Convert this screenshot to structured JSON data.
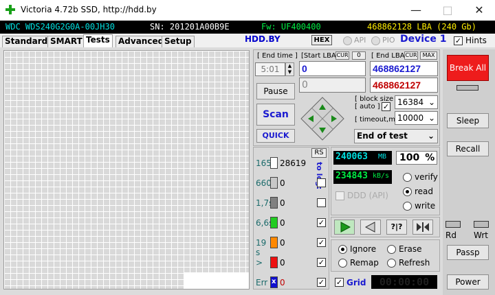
{
  "window": {
    "title": "Victoria 4.72b SSD, http://hdd.by"
  },
  "infobar": {
    "model": "WDC WDS240G2G0A-00JH30",
    "serial": "SN: 201201A00B9E",
    "firmware": "Fw: UF400400",
    "capacity": "468862128 LBA (240 Gb)"
  },
  "tabs": [
    "Standard",
    "SMART",
    "Tests",
    "Advanced",
    "Setup"
  ],
  "header": {
    "site": "HDD.BY",
    "hex": "HEX",
    "api": "API",
    "pio": "PIO",
    "device": "Device 1",
    "hints": "Hints"
  },
  "times": {
    "end_time_label": "[ End time ]",
    "end_time": "5:01",
    "start_lba_label": "[Start LBA]",
    "cur": "CUR",
    "zero": "0",
    "end_lba_label": "[ End LBA]",
    "max": "MAX",
    "start_lba": "0",
    "end_lba": "468862127",
    "cur_lba": "0",
    "end_lba_red": "468862127"
  },
  "controls": {
    "pause": "Pause",
    "scan": "Scan",
    "quick": "QUICK",
    "block_size_label": "[ block size ]",
    "auto_label": "[ auto ]",
    "block_size": "16384",
    "timeout_label": "[ timeout,ms ]",
    "timeout": "10000",
    "end_action": "End of test"
  },
  "stats": {
    "rs": "RS",
    "to_log": "to log:",
    "rows": [
      {
        "label": "165",
        "count": "28619",
        "color": "#ffffff"
      },
      {
        "label": "660",
        "count": "0",
        "color": "#c8c8c8"
      },
      {
        "label": "1,7s",
        "count": "0",
        "color": "#808080"
      },
      {
        "label": "6,6s",
        "count": "0",
        "color": "#22cc22"
      },
      {
        "label": "19 s",
        "count": "0",
        "color": "#ff8800"
      },
      {
        "label": ">",
        "count": "0",
        "color": "#ee1111"
      },
      {
        "label": "Err",
        "count": "0",
        "color": "#1010d0"
      }
    ]
  },
  "progress": {
    "mb": "240063",
    "mb_unit": "MB",
    "percent": "100",
    "percent_unit": "%",
    "speed": "234843",
    "speed_unit": "kB/s",
    "ddd": "DDD (API)"
  },
  "mode": {
    "verify": "verify",
    "read": "read",
    "write": "write",
    "selected": "read"
  },
  "actions": {
    "ignore": "Ignore",
    "erase": "Erase",
    "remap": "Remap",
    "refresh": "Refresh",
    "selected": "Ignore",
    "grid": "Grid",
    "timer": "00:00:00"
  },
  "right": {
    "break_all": "Break All",
    "sleep": "Sleep",
    "recall": "Recall",
    "rd": "Rd",
    "wrt": "Wrt",
    "passp": "Passp",
    "power": "Power"
  },
  "colors": {
    "blue_value": "#1a1ad0",
    "red_value": "#c00000",
    "lcd_cyan": "#00e0e0",
    "lcd_green": "#00ee44"
  }
}
